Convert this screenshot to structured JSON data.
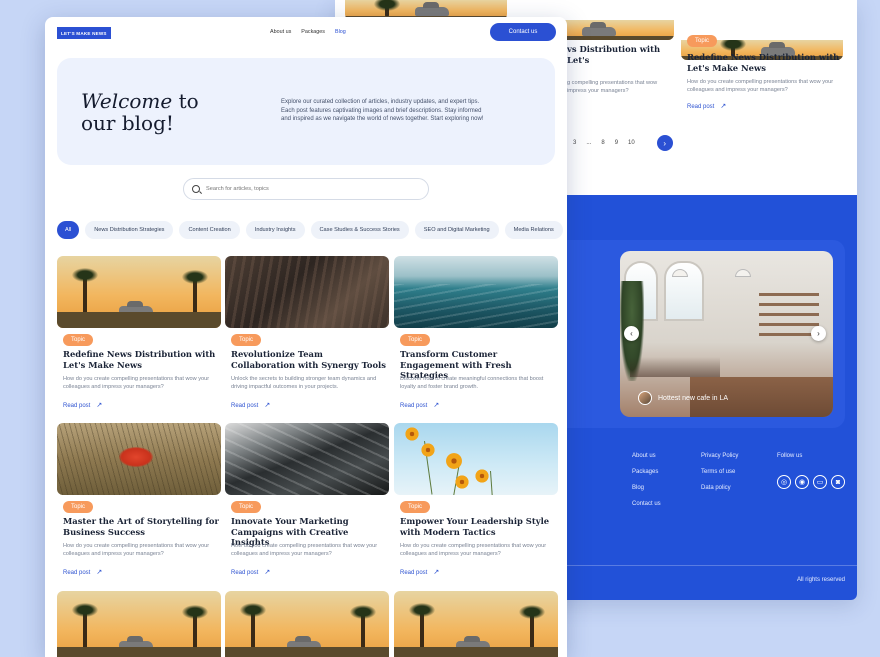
{
  "header": {
    "logo": "LET'S MAKE NEWS",
    "nav": [
      "About us",
      "Packages",
      "Blog"
    ],
    "active_nav": "Blog",
    "contact": "Contact us"
  },
  "hero": {
    "title_italic": "Welcome",
    "title_rest": "to our blog!",
    "description": "Explore our curated collection of articles, industry updates, and expert tips. Each post features captivating images and brief descriptions. Stay informed and inspired as we navigate the world of news together. Start exploring now!"
  },
  "search": {
    "placeholder": "Search for articles, topics"
  },
  "filters": [
    "All",
    "News Distribution Strategies",
    "Content Creation",
    "Industry Insights",
    "Case Studies & Success Stories",
    "SEO and Digital Marketing",
    "Media Relations"
  ],
  "posts": [
    {
      "tag": "Topic",
      "title": "Redefine News Distribution with Let's Make News",
      "desc": "How do you create compelling presentations that wow your colleagues and impress your managers?",
      "link": "Read post"
    },
    {
      "tag": "Topic",
      "title": "Revolutionize Team Collaboration with Synergy Tools",
      "desc": "Unlock the secrets to building stronger team dynamics and driving impactful outcomes in your projects.",
      "link": "Read post"
    },
    {
      "tag": "Topic",
      "title": "Transform Customer Engagement with Fresh Strategies",
      "desc": "Discover how to create meaningful connections that boost loyalty and foster brand growth.",
      "link": "Read post"
    },
    {
      "tag": "Topic",
      "title": "Master the Art of Storytelling for Business Success",
      "desc": "How do you create compelling presentations that wow your colleagues and impress your managers?",
      "link": "Read post"
    },
    {
      "tag": "Topic",
      "title": "Innovate Your Marketing Campaigns with Creative Insights",
      "desc": "How do you create compelling presentations that wow your colleagues and impress your managers?",
      "link": "Read post"
    },
    {
      "tag": "Topic",
      "title": "Empower Your Leadership Style with Modern Tactics",
      "desc": "How do you create compelling presentations that wow your colleagues and impress your managers?",
      "link": "Read post"
    }
  ],
  "back": {
    "cards": [
      {
        "title": "vs Distribution with Let's",
        "desc": "g compelling presentations that wow\nimpress your managers?"
      },
      {
        "tag": "Topic",
        "title": "Redefine News Distribution with Let's Make News",
        "desc": "How do you create compelling presentations that wow your colleagues and impress your managers?",
        "link": "Read post"
      }
    ],
    "pagination": [
      "3",
      "...",
      "8",
      "9",
      "10"
    ],
    "slider_caption": "Hottest new cafe in LA",
    "footer_col1": [
      "About us",
      "Packages",
      "Blog",
      "Contact us"
    ],
    "footer_col2": [
      "Privacy Policy",
      "Terms of use",
      "Data policy"
    ],
    "follow": "Follow us",
    "copyright": "All rights reserved"
  },
  "colors": {
    "accent": "#2b50d3",
    "footer": "#2251d8",
    "tag": "#f79a5c",
    "hero_bg": "#edf2fd"
  },
  "icons": [
    "search-icon",
    "arrow-up-right-icon",
    "chevron-right-icon",
    "chevron-left-icon",
    "social-icon"
  ]
}
